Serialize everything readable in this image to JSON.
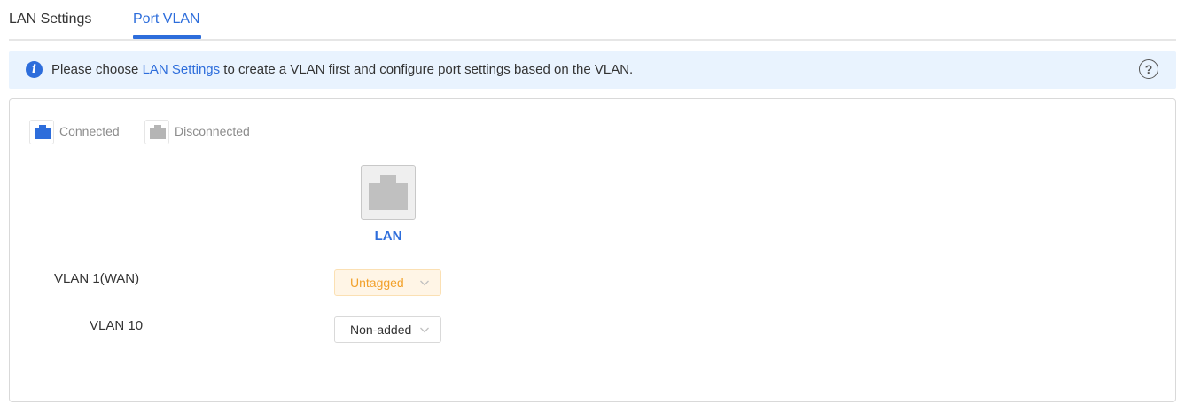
{
  "tabs": [
    {
      "label": "LAN Settings",
      "active": false
    },
    {
      "label": "Port VLAN",
      "active": true
    }
  ],
  "banner": {
    "prefix": "Please choose ",
    "link": "LAN Settings",
    "suffix": " to create a VLAN first and configure port settings based on the VLAN.",
    "info_icon": "info-icon",
    "help_icon": "help-icon"
  },
  "legend": {
    "connected": {
      "label": "Connected",
      "color": "#2d6ddb"
    },
    "disconnected": {
      "label": "Disconnected",
      "color": "#b5b5b5"
    }
  },
  "port": {
    "label": "LAN",
    "status": "disconnected"
  },
  "vlans": [
    {
      "label": "VLAN 1(WAN)",
      "value": "Untagged"
    },
    {
      "label": "VLAN 10",
      "value": "Non-added"
    }
  ],
  "colors": {
    "accent": "#2d6ddb",
    "untagged_text": "#f2a12b",
    "untagged_bg": "#fff5e6",
    "banner_bg": "#e9f3fe"
  }
}
